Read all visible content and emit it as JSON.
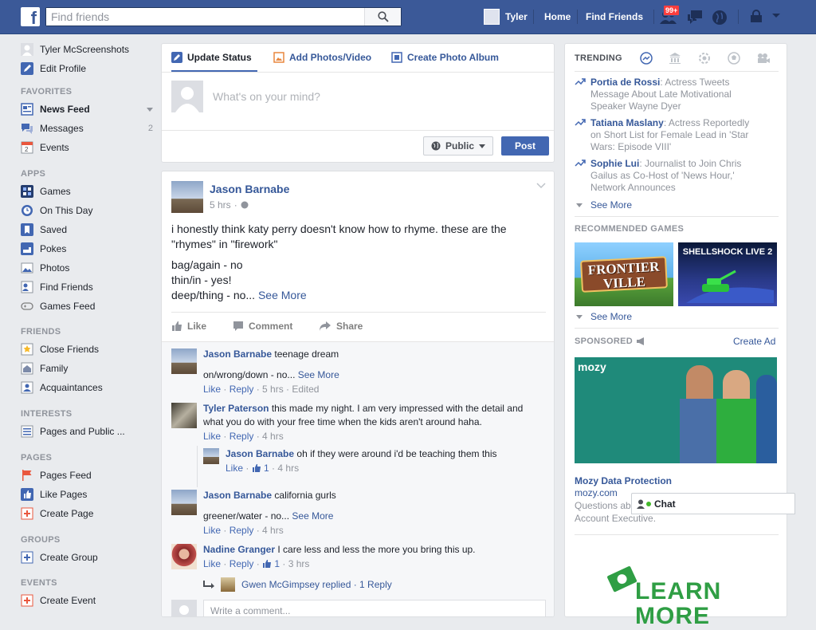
{
  "topbar": {
    "logo": "f",
    "search_placeholder": "Find friends",
    "user_name": "Tyler",
    "home": "Home",
    "find_friends": "Find Friends",
    "friend_request_badge": "99+"
  },
  "left": {
    "profile_name": "Tyler McScreenshots",
    "edit_profile": "Edit Profile",
    "favorites_head": "FAVORITES",
    "news_feed": "News Feed",
    "messages": "Messages",
    "messages_count": "2",
    "events": "Events",
    "apps_head": "APPS",
    "apps": [
      "Games",
      "On This Day",
      "Saved",
      "Pokes",
      "Photos",
      "Find Friends",
      "Games Feed"
    ],
    "friends_head": "FRIENDS",
    "friends": [
      "Close Friends",
      "Family",
      "Acquaintances"
    ],
    "interests_head": "INTERESTS",
    "interests_item": "Pages and Public ...",
    "pages_head": "PAGES",
    "pages": [
      "Pages Feed",
      "Like Pages",
      "Create Page"
    ],
    "groups_head": "GROUPS",
    "create_group": "Create Group",
    "events_head": "EVENTS",
    "create_event": "Create Event"
  },
  "composer": {
    "tab_status": "Update Status",
    "tab_photo": "Add Photos/Video",
    "tab_album": "Create Photo Album",
    "placeholder": "What's on your mind?",
    "privacy": "Public",
    "post": "Post"
  },
  "post": {
    "author": "Jason Barnabe",
    "time": "5 hrs",
    "text1": "i honestly think katy perry doesn't know how to rhyme. these are the",
    "text2": "\"rhymes\" in \"firework\"",
    "text3": "bag/again - no",
    "text4": "thin/in - yes!",
    "text5": "deep/thing - no...",
    "see_more": "See More",
    "like": "Like",
    "comment": "Comment",
    "share": "Share"
  },
  "comments": [
    {
      "name": "Jason Barnabe",
      "text": "teenage dream",
      "text2": "on/wrong/down - no...",
      "see_more": "See More",
      "like": "Like",
      "reply": "Reply",
      "meta": "5 hrs · Edited"
    },
    {
      "name": "Tyler Paterson",
      "text": "this made my night. I am very impressed with the detail and",
      "text2": "what you do with your free time when the kids aren't around haha.",
      "like": "Like",
      "reply": "Reply",
      "meta": "4 hrs"
    },
    {
      "name": "Jason Barnabe",
      "text": "oh if they were around i'd be teaching them this",
      "like": "Like",
      "likes": "1",
      "meta": "4 hrs"
    },
    {
      "name": "Jason Barnabe",
      "text": "california gurls",
      "text2": "greener/water - no...",
      "see_more": "See More",
      "like": "Like",
      "reply": "Reply",
      "meta": "4 hrs"
    },
    {
      "name": "Nadine Granger",
      "text": "I care less and less the more you bring this up.",
      "like": "Like",
      "reply": "Reply",
      "likes": "1",
      "meta": "3 hrs"
    }
  ],
  "reply_summary": "Gwen McGimpsey replied · 1 Reply",
  "write_comment": "Write a comment...",
  "right": {
    "trending_head": "TRENDING",
    "trends": [
      {
        "name": "Portia de Rossi",
        "l1": ": Actress Tweets",
        "l2": "Message About Late Motivational",
        "l3": "Speaker Wayne Dyer"
      },
      {
        "name": "Tatiana Maslany",
        "l1": ": Actress Reportedly",
        "l2": "on Short List for Female Lead in 'Star",
        "l3": "Wars: Episode VIII'"
      },
      {
        "name": "Sophie Lui",
        "l1": ": Journalist to Join Chris",
        "l2": "Gailus as Co-Host of 'News Hour,'",
        "l3": "Network Announces"
      }
    ],
    "see_more": "See More",
    "games_head": "RECOMMENDED GAMES",
    "game1": "FRONTIER VILLE",
    "game2": "SHELLSHOCK LIVE 2",
    "games_see_more": "See More",
    "sponsored_head": "SPONSORED",
    "create_ad": "Create Ad",
    "ad_brand": "mozy",
    "ad_title": "Mozy Data Protection",
    "ad_url": "mozy.com",
    "ad_desc1": "Questions ab",
    "ad_desc2": "Account Executive.",
    "learn": "LEARN",
    "more": "MORE"
  },
  "chat": "Chat"
}
